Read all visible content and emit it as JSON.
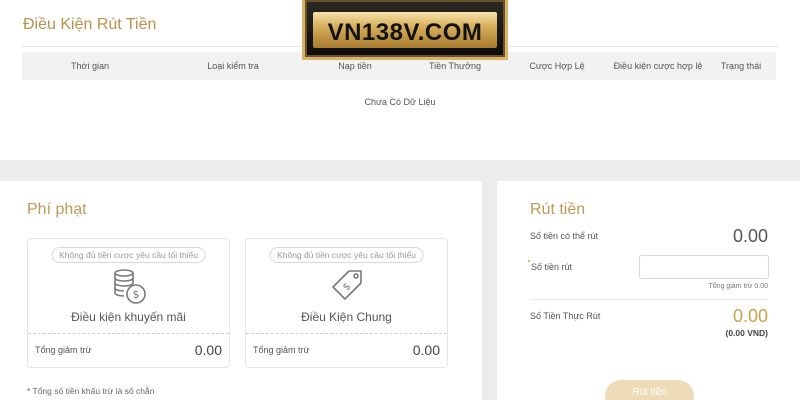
{
  "logo": {
    "text": "VN138V.COM"
  },
  "withdraw_conditions": {
    "title": "Điều Kiện Rút Tiền",
    "columns": [
      "Thời gian",
      "Loại kiểm tra",
      "Nạp tiền",
      "Tiền Thưởng",
      "Cược Hợp Lệ",
      "Điều kiện cược hợp lệ",
      "Trạng thái"
    ],
    "empty_message": "Chưa Có Dữ Liệu"
  },
  "penalty": {
    "title": "Phí phạt",
    "boxes": [
      {
        "badge": "Không đủ tiền cược yêu cầu tối thiểu",
        "icon": "coins-dollar-icon",
        "label": "Điều kiện khuyến mãi",
        "total_label": "Tổng giảm trừ",
        "total_value": "0.00"
      },
      {
        "badge": "Không đủ tiền cược yêu cầu tối thiểu",
        "icon": "price-tag-dollar-icon",
        "label": "Điều Kiện Chung",
        "total_label": "Tổng giảm trừ",
        "total_value": "0.00"
      }
    ],
    "note": "* Tổng số tiền khấu trừ là số chẵn"
  },
  "withdraw": {
    "title": "Rút tiền",
    "available_label": "Số tiền có thể rút",
    "available_value": "0.00",
    "amount_label": "Số tiền rút",
    "amount_value": "",
    "amount_placeholder": "",
    "deduction_hint": "Tổng giảm trừ 0.00",
    "actual_label": "Số Tiền Thực Rút",
    "actual_value": "0.00",
    "actual_vnd": "(0.00 VND)",
    "button_label": "Rút tiền"
  },
  "colors": {
    "accent_gold": "#c09a55",
    "button_disabled": "#eedcb8"
  }
}
